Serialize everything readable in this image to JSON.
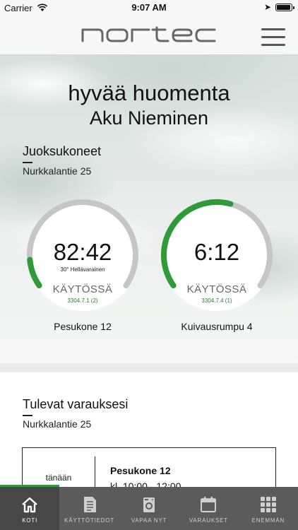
{
  "status_bar": {
    "carrier": "Carrier",
    "time": "9:07 AM"
  },
  "header": {
    "logo_text": "nortec",
    "menu_icon": "hamburger-menu-icon"
  },
  "greeting": {
    "line1": "hyvää huomenta",
    "line2": "Aku Nieminen"
  },
  "machines_section": {
    "title": "Juoksukoneet",
    "address": "Nurkkalantie 25",
    "machines": [
      {
        "time_left": "82:42",
        "program": "30° Hellävarainen",
        "status": "KÄYTÖSSÄ",
        "code": "3304.7.1 (2)",
        "name": "Pesukone 12",
        "progress": 0.12
      },
      {
        "time_left": "6:12",
        "program": "",
        "status": "KÄYTÖSSÄ",
        "code": "3304.7.4 (1)",
        "name": "Kuivausrumpu 4",
        "progress": 0.56
      }
    ]
  },
  "reservations": {
    "title": "Tulevat varauksesi",
    "address": "Nurkkalantie 25",
    "items": [
      {
        "day": "tänään",
        "machine": "Pesukone 12",
        "time": "kl. 10:00 - 12:00"
      }
    ]
  },
  "tabs": [
    {
      "label": "KOTI",
      "icon": "home-icon",
      "active": true
    },
    {
      "label": "KÄYTTÖTIEDOT",
      "icon": "document-icon",
      "active": false
    },
    {
      "label": "VAPAA NYT",
      "icon": "washing-machine-icon",
      "active": false
    },
    {
      "label": "VARAUKSET",
      "icon": "calendar-icon",
      "active": false
    },
    {
      "label": "ENEMMÄN",
      "icon": "grid-icon",
      "active": false
    }
  ],
  "colors": {
    "accent_green": "#2e9a38",
    "ring_gray": "#c6c6c6",
    "tabbar": "#5b5b5b"
  }
}
